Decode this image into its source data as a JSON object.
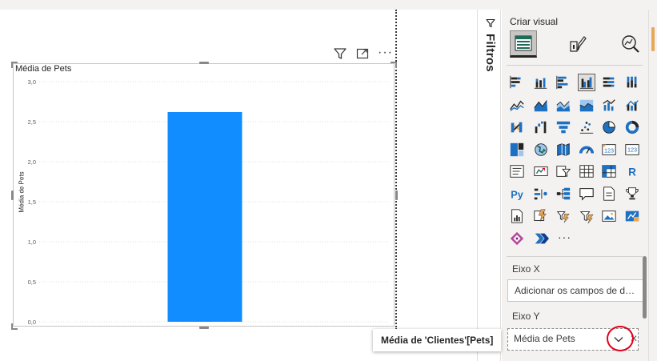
{
  "visual": {
    "title": "Média de Pets",
    "header_icons": [
      "filter-icon",
      "focus-mode-icon",
      "more-options-icon"
    ],
    "more_label": "···"
  },
  "chart_data": {
    "type": "bar",
    "categories": [
      ""
    ],
    "series": [
      {
        "name": "Média de Pets",
        "values": [
          2.62
        ]
      }
    ],
    "ylabel": "Média de Pets",
    "xlabel": "",
    "ylim": [
      0,
      3
    ],
    "yticks": [
      "0,0",
      "0,5",
      "1,0",
      "1,5",
      "2,0",
      "2,5",
      "3,0"
    ],
    "bar_color": "#118dff",
    "grid": true
  },
  "filters_pane": {
    "label": "Filtros"
  },
  "viz_pane": {
    "title": "Criar visual",
    "more_visuals": "···",
    "x_axis_label": "Eixo X",
    "x_axis_placeholder": "Adicionar os campos de da...",
    "y_axis_label": "Eixo Y",
    "y_axis_field": "Média de Pets",
    "remove_symbol": "✕"
  },
  "tooltip": {
    "text": "Média de 'Clientes'[Pets]"
  },
  "colors": {
    "accent": "#118dff",
    "highlight_circle": "#e3001b",
    "pane_bg": "#f3f2f1"
  }
}
